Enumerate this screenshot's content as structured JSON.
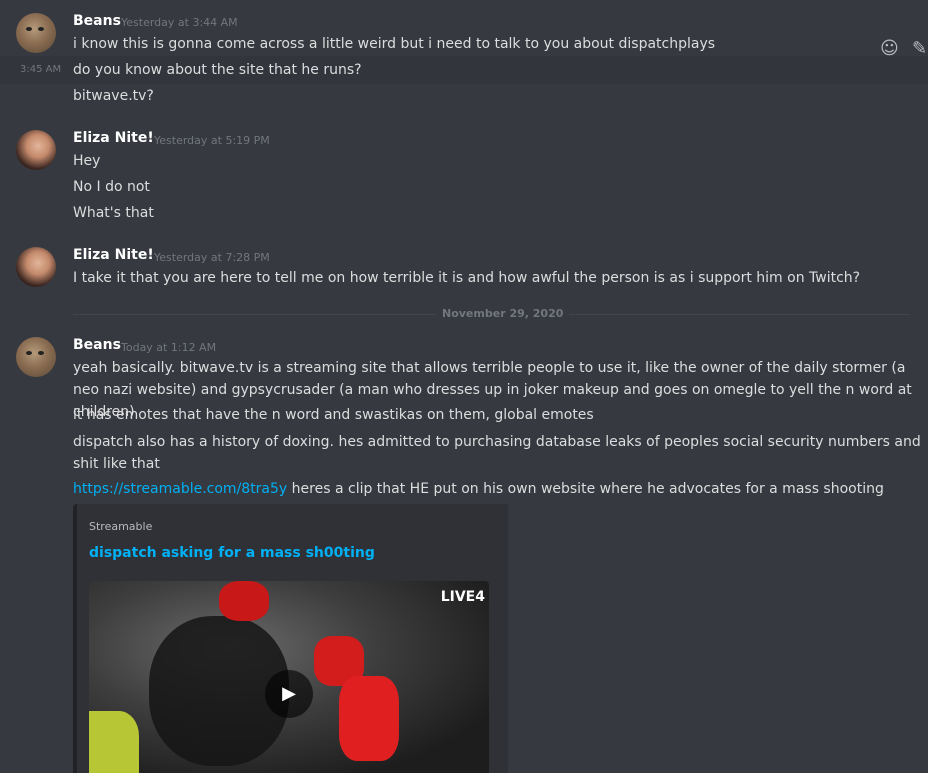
{
  "divider": {
    "label": "November 29, 2020"
  },
  "toolbar": {
    "reaction_icon": "add-reaction-icon",
    "edit_icon": "pencil-icon"
  },
  "groups": [
    {
      "username": "Beans",
      "timestamp": "Yesterday at 3:44 AM",
      "hover_time": "3:45 AM",
      "messages": [
        "i know this is gonna come across a little weird but i need to talk to you about dispatchplays",
        "do you know about the site that he runs?",
        "bitwave.tv?"
      ]
    },
    {
      "username": "Eliza Nite",
      "badge": "!",
      "timestamp": "Yesterday at 5:19 PM",
      "messages": [
        "Hey",
        "No I do not",
        "What's that"
      ]
    },
    {
      "username": "Eliza Nite",
      "badge": "!",
      "timestamp": "Yesterday at 7:28 PM",
      "messages": [
        "I take it that you are here to tell me on how terrible it is and how awful the person is as i support him on Twitch?"
      ]
    },
    {
      "username": "Beans",
      "timestamp": "Today at 1:12 AM",
      "messages": [
        "yeah basically. bitwave.tv is a streaming site that allows terrible people to use it, like the owner of the daily stormer (a neo nazi website) and gypsycrusader (a man who dresses up in joker makeup and goes on omegle to yell the n word at children)",
        "it has emotes that have the n word and swastikas on them, global emotes",
        "dispatch also has a history of doxing. hes admitted to purchasing database leaks of peoples social security numbers and shit like that"
      ],
      "link": "https://streamable.com/8tra5y",
      "link_after": " heres a clip that HE put on his own website where he advocates for a mass shooting",
      "embed": {
        "provider": "Streamable",
        "title": "dispatch asking for a mass sh00ting",
        "live_label": "LIVE4",
        "play_icon": "play-icon"
      }
    }
  ]
}
